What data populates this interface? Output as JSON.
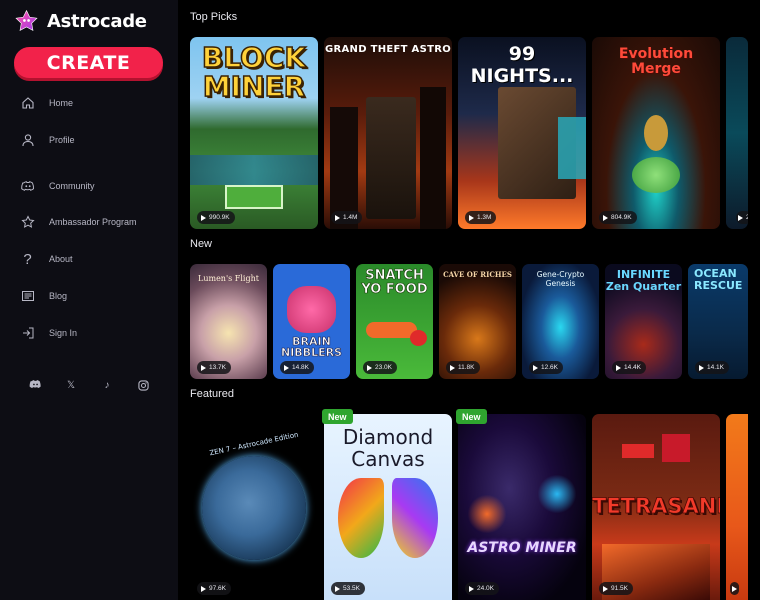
{
  "app": {
    "name": "Astrocade",
    "create_label": "CREATE"
  },
  "sidebar": {
    "nav": [
      {
        "label": "Home",
        "icon": "home-icon"
      },
      {
        "label": "Profile",
        "icon": "profile-icon"
      },
      {
        "label": "Community",
        "icon": "discord-icon"
      },
      {
        "label": "Ambassador Program",
        "icon": "star-icon"
      },
      {
        "label": "About",
        "icon": "question-icon"
      },
      {
        "label": "Blog",
        "icon": "newspaper-icon"
      },
      {
        "label": "Sign In",
        "icon": "sign-in-icon"
      }
    ],
    "social": [
      {
        "icon": "discord-icon"
      },
      {
        "icon": "x-icon",
        "glyph": "𝕏"
      },
      {
        "icon": "tiktok-icon",
        "glyph": "♪"
      },
      {
        "icon": "instagram-icon"
      }
    ]
  },
  "sections": {
    "top_picks": {
      "title": "Top Picks",
      "cards": [
        {
          "title": "BLOCK MINER",
          "plays": "990.9K"
        },
        {
          "title": "GRAND THEFT ASTRO",
          "plays": "1.4M"
        },
        {
          "title": "99 NIGHTS...",
          "plays": "1.3M"
        },
        {
          "title": "Evolution Merge",
          "plays": "804.9K"
        },
        {
          "title": "",
          "plays": "2"
        }
      ]
    },
    "new": {
      "title": "New",
      "cards": [
        {
          "title": "Lumen's Flight",
          "plays": "13.7K"
        },
        {
          "title": "BRAIN NIBBLERS",
          "plays": "14.8K"
        },
        {
          "title": "SNATCH YO FOOD",
          "plays": "23.0K"
        },
        {
          "title": "CAVE OF RICHES",
          "plays": "11.8K"
        },
        {
          "title": "Gene-Crypto Genesis",
          "plays": "12.6K"
        },
        {
          "title": "INFINITE Zen Quarter",
          "plays": "14.4K"
        },
        {
          "title": "OCEAN RESCUE",
          "plays": "14.1K"
        }
      ]
    },
    "featured": {
      "title": "Featured",
      "new_badge": "New",
      "cards": [
        {
          "title": "ZEN 7 – Astrocade Edition",
          "plays": "97.6K"
        },
        {
          "title": "Diamond Canvas",
          "plays": "53.5K"
        },
        {
          "title": "ASTRO MINER",
          "plays": "24.0K"
        },
        {
          "title": "TETRASAND",
          "plays": "91.5K"
        }
      ]
    }
  }
}
